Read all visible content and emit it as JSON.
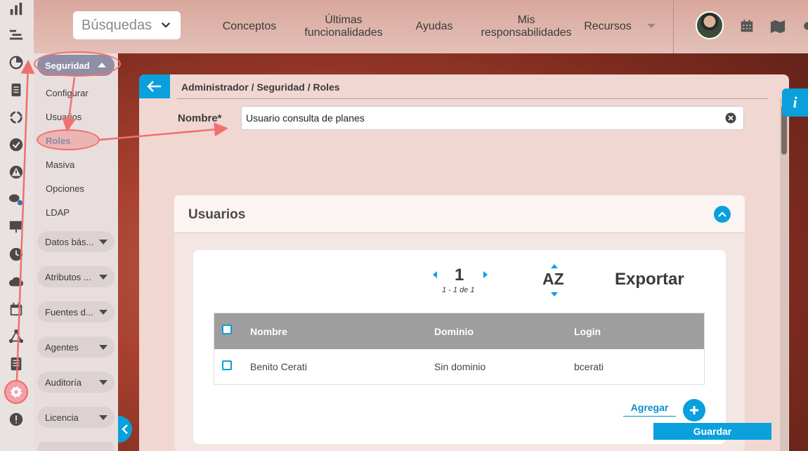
{
  "header": {
    "search_select": "Búsquedas",
    "nav": [
      {
        "label": "Conceptos"
      },
      {
        "label": "Últimas funcionalidades"
      },
      {
        "label": "Ayudas"
      },
      {
        "label": "Mis responsabilidades"
      },
      {
        "label": "Recursos"
      }
    ]
  },
  "rail_icons": [
    "bar-chart-icon",
    "gantt-icon",
    "pie-chart-icon",
    "document-icon",
    "cycle-icon",
    "check-circle-icon",
    "warning-icon",
    "chat-users-icon",
    "presentation-icon",
    "clock-icon",
    "cloud-icon",
    "calendar-icon",
    "network-icon",
    "list-icon",
    "gear-icon",
    "alert-icon"
  ],
  "submenu": {
    "section": "Seguridad",
    "links": [
      "Configurar",
      "Usuarios",
      "Roles",
      "Masiva",
      "Opciones",
      "LDAP"
    ],
    "groups": [
      "Datos bás...",
      "Atributos ...",
      "Fuentes d...",
      "Agentes",
      "Auditoría",
      "Licencia"
    ]
  },
  "main": {
    "breadcrumb": "Administrador / Seguridad / Roles",
    "name_label": "Nombre*",
    "name_value": "Usuario consulta de planes",
    "usuarios": {
      "title": "Usuarios",
      "pager": {
        "page": "1",
        "summary": "1 - 1 de 1"
      },
      "sort_label": "AZ",
      "export_label": "Exportar",
      "columns": [
        "Nombre",
        "Dominio",
        "Login"
      ],
      "rows": [
        {
          "nombre": "Benito Cerati",
          "dominio": "Sin dominio",
          "login": "bcerati"
        }
      ],
      "add_label": "Agregar"
    },
    "save_label": "Guardar"
  },
  "info_label": "i",
  "colors": {
    "accent": "#0aa0dc",
    "highlight": "#f07070"
  }
}
